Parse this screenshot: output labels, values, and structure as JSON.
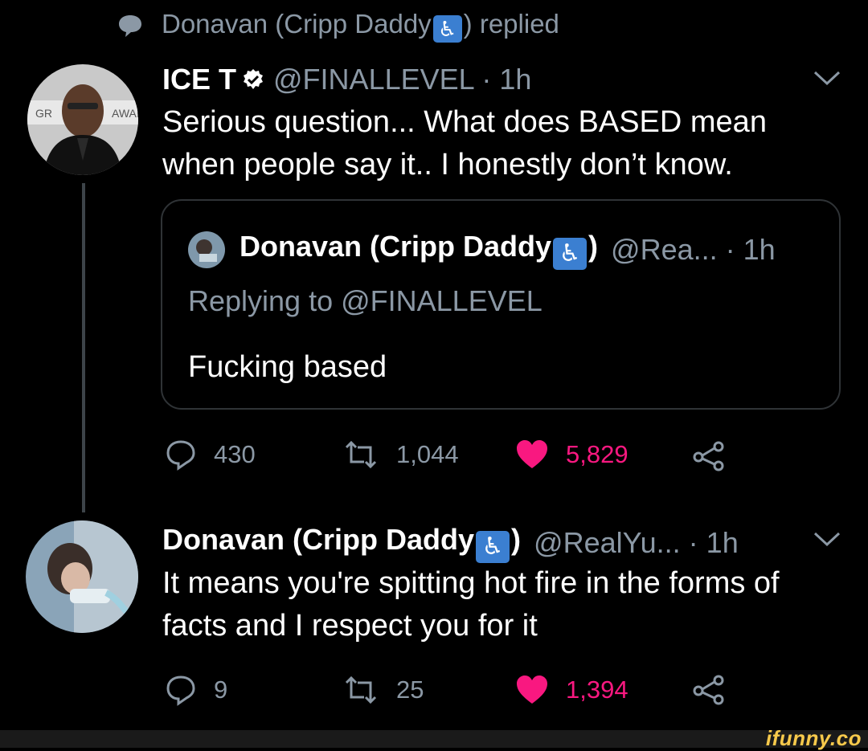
{
  "replied_bar": {
    "icon": "comment-bubble-icon",
    "prefix": "Donavan (Cripp Daddy",
    "badge": "wheelchair-icon",
    "suffix": ") replied"
  },
  "tweet1": {
    "name": "ICE T",
    "verified_icon": "verified-badge-icon",
    "handle_time": "@FINALLEVEL · 1h",
    "text": "Serious question... What does BASED mean when people say it.. I honestly don’t know.",
    "quote": {
      "name_prefix": "Donavan (Cripp Daddy",
      "name_suffix": ")",
      "handle_time": "@Rea... · 1h",
      "replying_to": "Replying to @FINALLEVEL",
      "text": "Fucking based"
    },
    "actions": {
      "replies": "430",
      "retweets": "1,044",
      "likes": "5,829"
    }
  },
  "tweet2": {
    "name_prefix": "Donavan (Cripp Daddy",
    "name_suffix": ")",
    "handle_time": "@RealYu... · 1h",
    "text": "It means you're spitting hot fire in the forms of facts and I respect you for it",
    "actions": {
      "replies": "9",
      "retweets": "25",
      "likes": "1,394"
    }
  },
  "watermark": "ifunny.co",
  "colors": {
    "background": "#000000",
    "muted": "#8b98a5",
    "like": "#f91880",
    "badge": "#3b7fd1",
    "border": "#2f3336"
  }
}
